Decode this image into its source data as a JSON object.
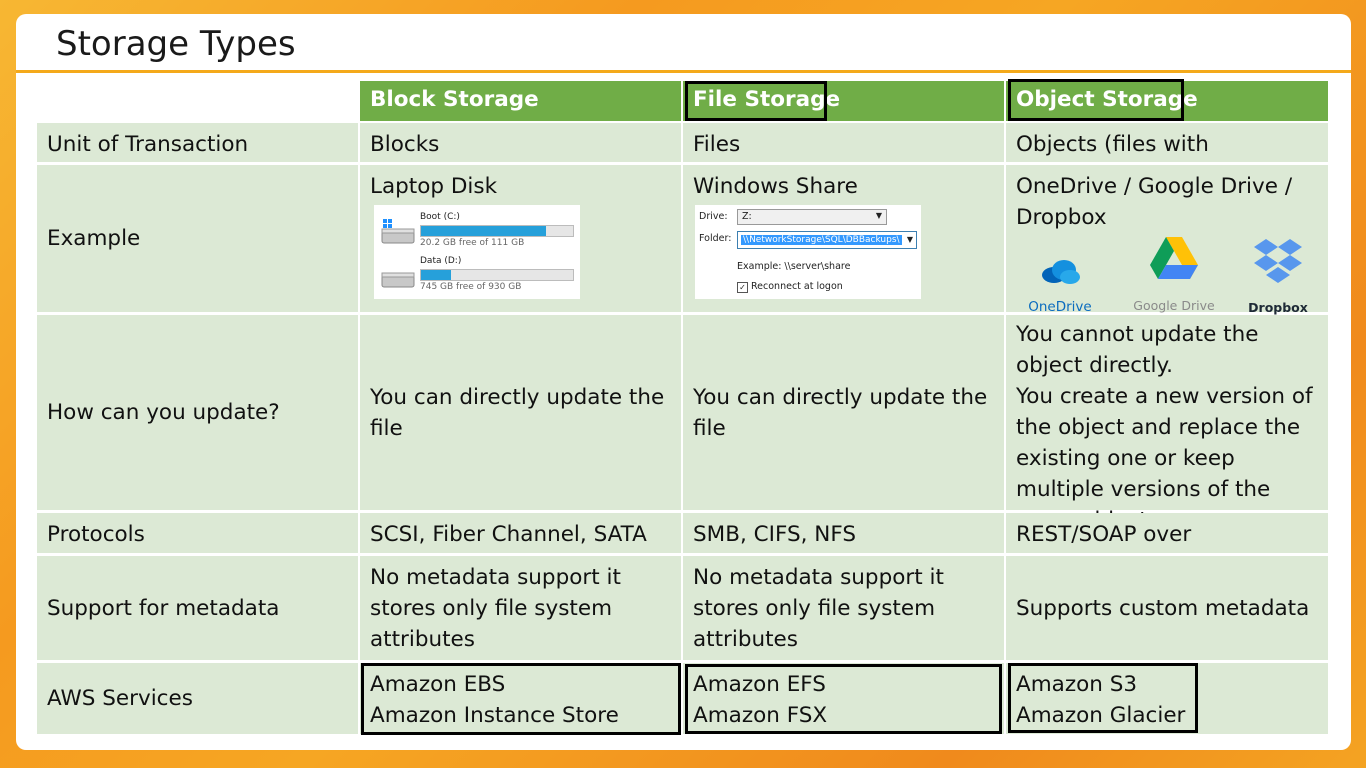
{
  "title": "Storage Types",
  "headers": [
    "",
    "Block Storage",
    "File Storage",
    "Object Storage"
  ],
  "rows": {
    "unit": {
      "label": "Unit of Transaction",
      "block": "Blocks",
      "file": "Files",
      "object": "Objects (files with metadata)"
    },
    "example": {
      "label": "Example",
      "block": "Laptop Disk",
      "file": "Windows Share",
      "object": "OneDrive / Google Drive / Dropbox"
    },
    "update": {
      "label": "How can you update?",
      "block": "You can directly update the file",
      "file": "You can directly update the file",
      "object": "You cannot update the object directly.\nYou create a new version of the object and replace the existing one or keep multiple versions of the same object."
    },
    "protocols": {
      "label": "Protocols",
      "block": "SCSI, Fiber Channel, SATA",
      "file": "SMB, CIFS, NFS",
      "object": "REST/SOAP over HTTP/HTTPs"
    },
    "metadata": {
      "label": "Support for metadata",
      "block": "No metadata support it stores only file system attributes",
      "file": "No metadata support it stores only file system attributes",
      "object": "Supports custom metadata"
    },
    "aws": {
      "label": "AWS Services",
      "block": "Amazon EBS\nAmazon Instance Store",
      "file": "Amazon EFS\nAmazon FSX",
      "object": "Amazon S3\nAmazon Glacier"
    }
  },
  "disk_widget": {
    "drives": [
      {
        "name": "Boot (C:)",
        "free": "20.2 GB free of 111 GB",
        "used_fraction": 0.82
      },
      {
        "name": "Data (D:)",
        "free": "745 GB free of 930 GB",
        "used_fraction": 0.2
      }
    ]
  },
  "share_widget": {
    "drive_label": "Drive:",
    "drive_value": "Z:",
    "folder_label": "Folder:",
    "folder_value": "\\\\NetworkStorage\\SQL\\DBBackups\\",
    "example": "Example: \\\\server\\share",
    "reconnect": "Reconnect at logon"
  },
  "logos": {
    "onedrive": "OneDrive",
    "gdrive": "Google Drive",
    "dropbox": "Dropbox"
  },
  "colors": {
    "header_green": "#70ad47",
    "cell_green": "#dce9d5",
    "accent_orange": "#f4a91a"
  }
}
